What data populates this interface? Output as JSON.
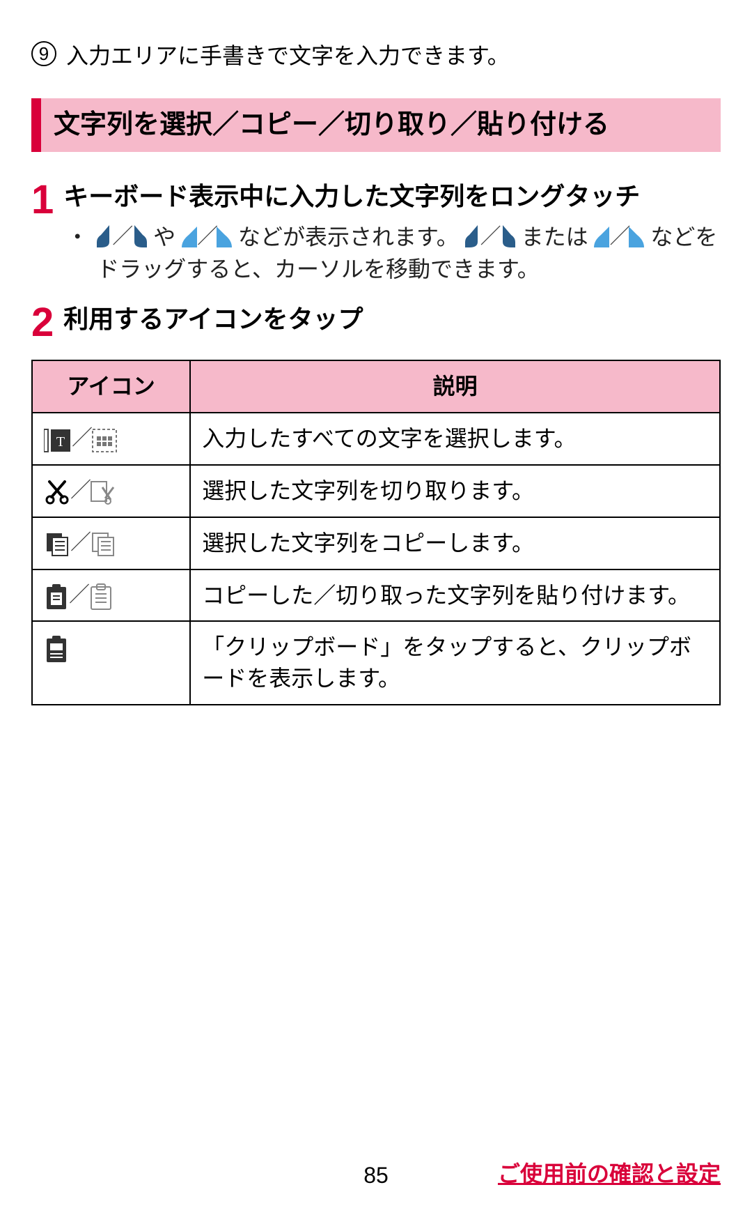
{
  "top_note": {
    "number": "9",
    "text": "入力エリアに手書きで文字を入力できます。"
  },
  "section_title": "文字列を選択／コピー／切り取り／貼り付ける",
  "step1": {
    "num": "1",
    "title": "キーボード表示中に入力した文字列をロングタッチ",
    "bullet_a": " や ",
    "bullet_b": " などが表示されます。",
    "bullet_c": " または ",
    "bullet_d": " などをドラッグすると、カーソルを移動できます。"
  },
  "step2": {
    "num": "2",
    "title": "利用するアイコンをタップ"
  },
  "table": {
    "head_icon": "アイコン",
    "head_desc": "説明",
    "rows": [
      {
        "desc": "入力したすべての文字を選択します。"
      },
      {
        "desc": "選択した文字列を切り取ります。"
      },
      {
        "desc": "選択した文字列をコピーします。"
      },
      {
        "desc": "コピーした／切り取った文字列を貼り付けます。"
      },
      {
        "desc": "「クリップボード」をタップすると、クリップボードを表示します。"
      }
    ]
  },
  "page_number": "85",
  "footer_link": "ご使用前の確認と設定"
}
